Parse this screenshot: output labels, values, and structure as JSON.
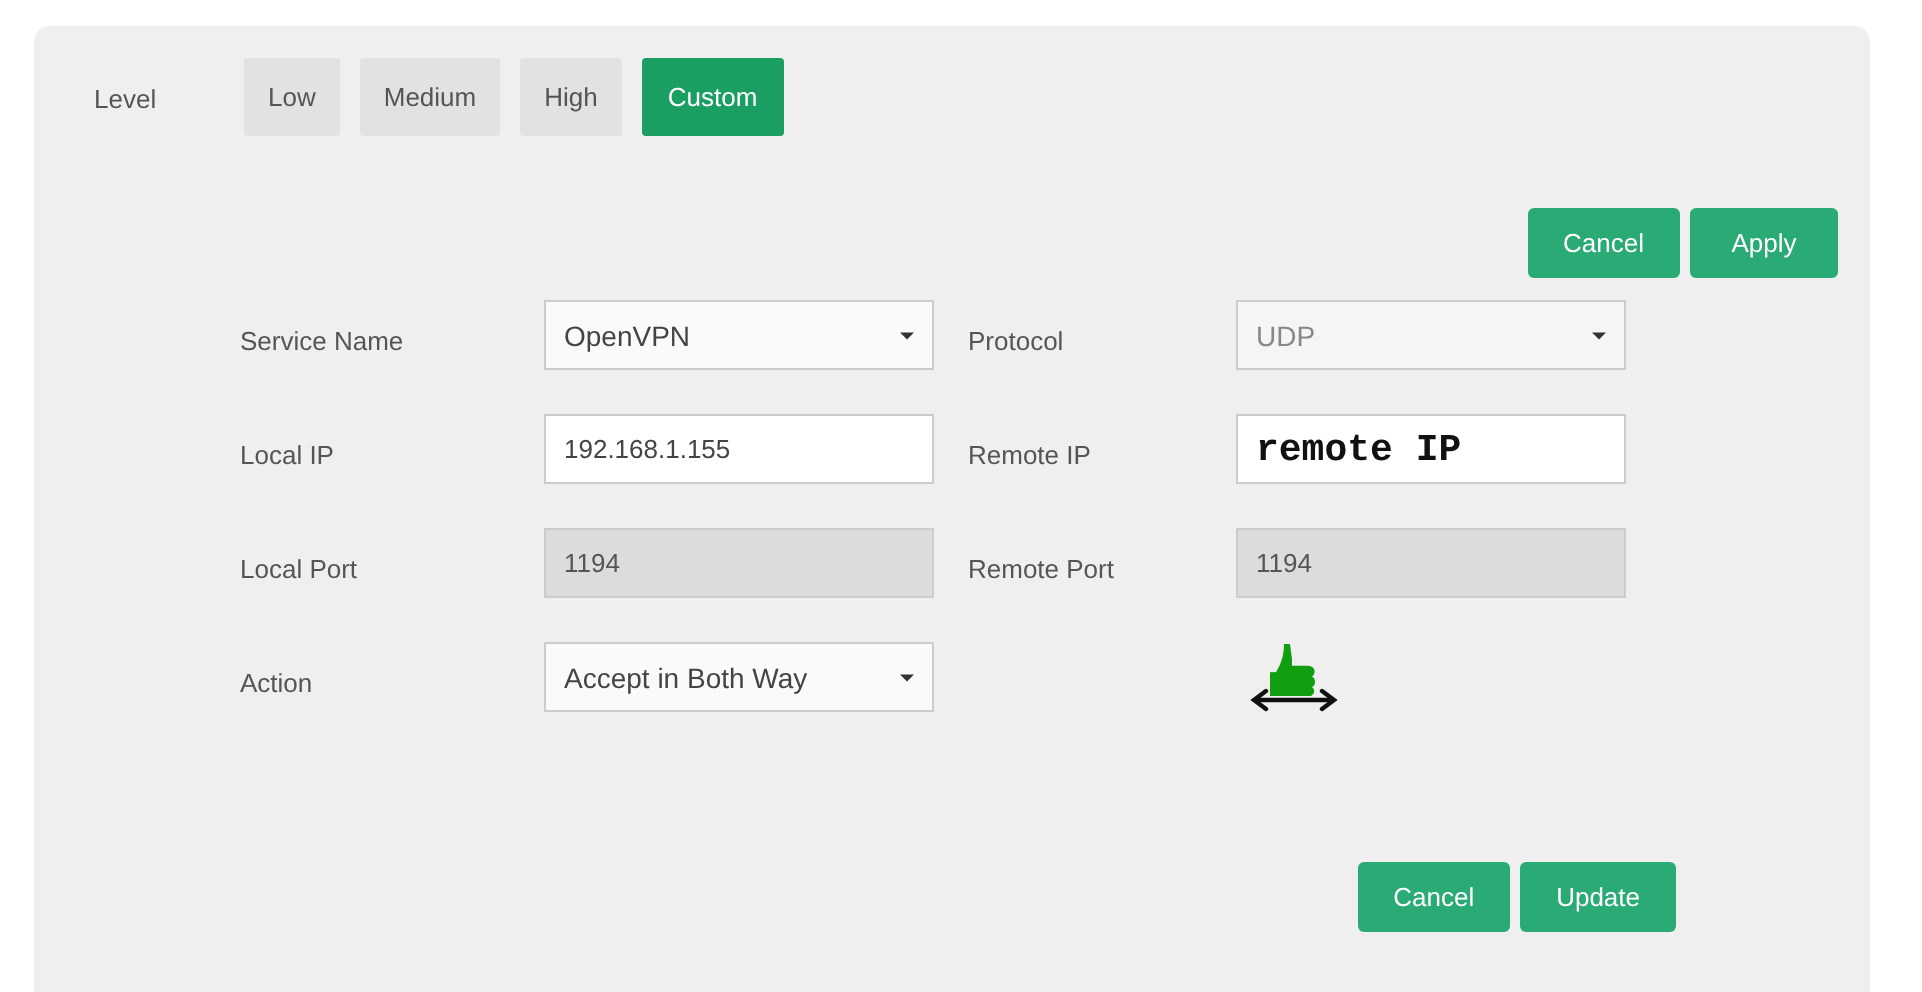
{
  "level": {
    "label": "Level",
    "tabs": [
      {
        "label": "Low",
        "selected": false
      },
      {
        "label": "Medium",
        "selected": false
      },
      {
        "label": "High",
        "selected": false
      },
      {
        "label": "Custom",
        "selected": true
      }
    ]
  },
  "top_buttons": [
    "Cancel",
    "Apply"
  ],
  "fields": [
    {
      "label": "Service Name",
      "kind": "select",
      "value": "OpenVPN",
      "disabled": false
    },
    {
      "label": "Protocol",
      "kind": "select",
      "value": "UDP",
      "disabled": true
    },
    {
      "label": "Local IP",
      "kind": "text",
      "value": "192.168.1.155",
      "disabled": false
    },
    {
      "label": "Remote IP",
      "kind": "monotext",
      "value": "remote IP",
      "disabled": false
    },
    {
      "label": "Local Port",
      "kind": "text",
      "value": "1194",
      "disabled": true
    },
    {
      "label": "Remote Port",
      "kind": "text",
      "value": "1194",
      "disabled": true
    },
    {
      "label": "Action",
      "kind": "select",
      "value": "Accept in Both Way",
      "disabled": false
    },
    {
      "kind": "indicator"
    }
  ],
  "bottom_buttons": [
    "Cancel",
    "Update"
  ]
}
